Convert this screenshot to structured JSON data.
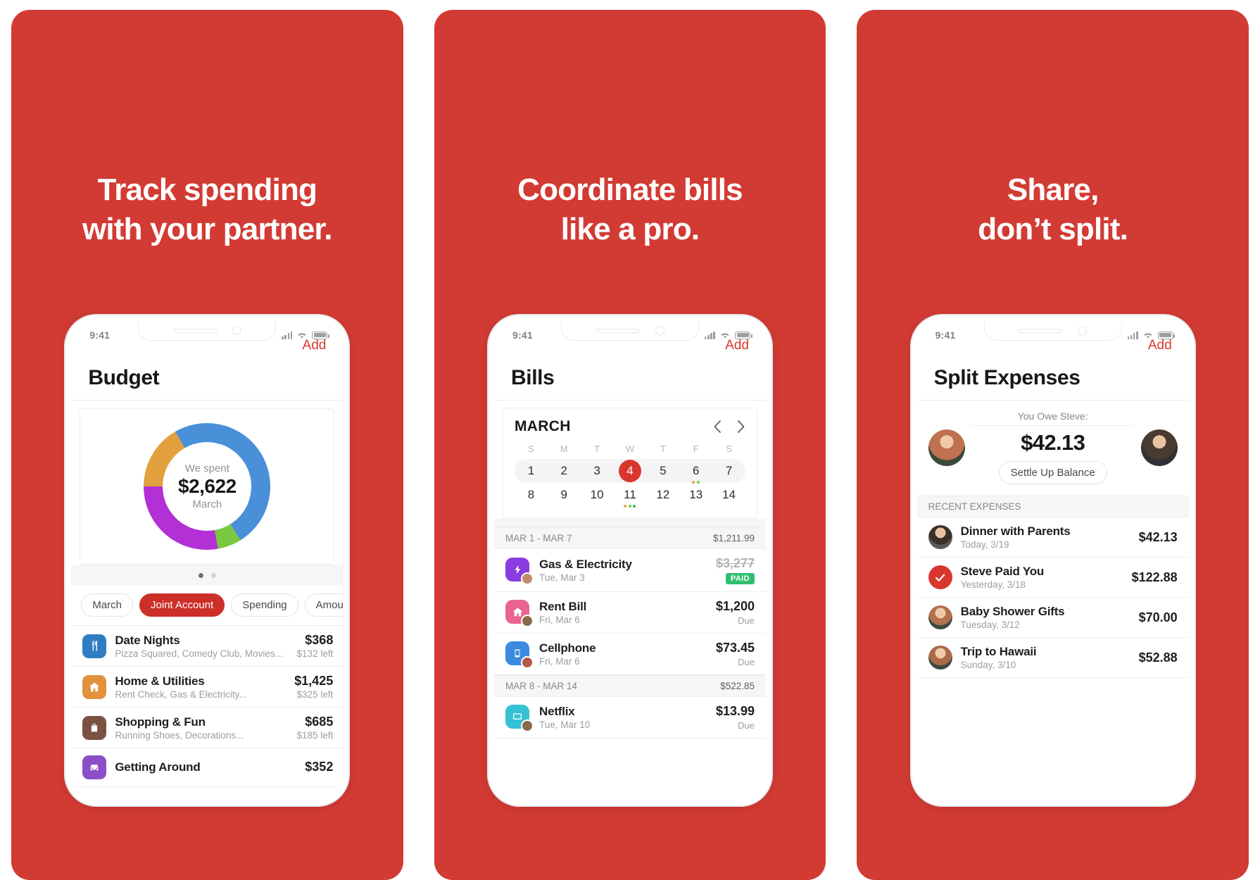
{
  "brand": {
    "red": "#d23b34",
    "accent": "#d9372e",
    "pill_red": "#cc2e28",
    "green": "#2fbf6f"
  },
  "panels": [
    {
      "headline_line1": "Track spending",
      "headline_line2": "with your partner.",
      "status": {
        "time": "9:41"
      },
      "nav": {
        "action": "Add",
        "title": "Budget"
      }
    },
    {
      "headline_line1": "Coordinate bills",
      "headline_line2": "like a pro.",
      "status": {
        "time": "9:41"
      },
      "nav": {
        "action": "Add",
        "title": "Bills"
      }
    },
    {
      "headline_line1": "Share,",
      "headline_line2": "don’t split.",
      "status": {
        "time": "9:41"
      },
      "nav": {
        "action": "Add",
        "title": "Split Expenses"
      }
    }
  ],
  "budget": {
    "donut": {
      "label_top": "We spent",
      "amount": "$2,622",
      "label_sub": "March"
    },
    "carousel": {
      "pages": 2,
      "active": 1
    },
    "pills": [
      {
        "label": "March",
        "active": false
      },
      {
        "label": "Joint Account",
        "active": true
      },
      {
        "label": "Spending",
        "active": false
      },
      {
        "label": "Amount: H",
        "active": false
      }
    ],
    "rows": [
      {
        "icon": "cutlery-icon",
        "color": "#2f7ec1",
        "title": "Date Nights",
        "sub": "Pizza Squared, Comedy Club, Movies...",
        "amount": "$368",
        "left": "$132 left"
      },
      {
        "icon": "home-icon",
        "color": "#e2913c",
        "title": "Home & Utilities",
        "sub": "Rent Check, Gas & Electricity...",
        "amount": "$1,425",
        "left": "$325 left"
      },
      {
        "icon": "bag-icon",
        "color": "#7a5242",
        "title": "Shopping & Fun",
        "sub": "Running Shoes, Decorations...",
        "amount": "$685",
        "left": "$185 left"
      },
      {
        "icon": "car-icon",
        "color": "#8a4fc7",
        "title": "Getting Around",
        "sub": "",
        "amount": "$352",
        "left": ""
      }
    ]
  },
  "chart_data": {
    "type": "pie",
    "title": "We spent $2,622 March",
    "labels": [
      "Home & Utilities",
      "Shopping & Fun",
      "Getting Around",
      "Date Nights"
    ],
    "values": [
      1425,
      685,
      352,
      368
    ],
    "colors": [
      "#4a90d9",
      "#b32fd6",
      "#e2a13c",
      "#7ac943"
    ],
    "segments": [
      {
        "name": "blue",
        "color": "#4a90d9",
        "start_deg": 0,
        "end_deg": 148
      },
      {
        "name": "green",
        "color": "#7ac943",
        "start_deg": 148,
        "end_deg": 170
      },
      {
        "name": "magenta",
        "color": "#b32fd6",
        "start_deg": 170,
        "end_deg": 270
      },
      {
        "name": "orange",
        "color": "#e2a13c",
        "start_deg": 270,
        "end_deg": 330
      },
      {
        "name": "blue2",
        "color": "#4a90d9",
        "start_deg": 330,
        "end_deg": 360
      }
    ],
    "center_text": [
      "We spent",
      "$2,622",
      "March"
    ],
    "legend": "none"
  },
  "bills": {
    "calendar": {
      "month": "MARCH",
      "prev_icon": "chevron-left-icon",
      "next_icon": "chevron-right-icon",
      "dow": [
        "S",
        "M",
        "T",
        "W",
        "T",
        "F",
        "S"
      ],
      "week1": [
        {
          "day": "1",
          "today": false,
          "dots": []
        },
        {
          "day": "2",
          "today": false,
          "dots": []
        },
        {
          "day": "3",
          "today": false,
          "dots": []
        },
        {
          "day": "4",
          "today": true,
          "dots": []
        },
        {
          "day": "5",
          "today": false,
          "dots": []
        },
        {
          "day": "6",
          "today": false,
          "dots": [
            "#e2a13c",
            "#7ac943"
          ]
        },
        {
          "day": "7",
          "today": false,
          "dots": []
        }
      ],
      "week2": [
        {
          "day": "8",
          "today": false,
          "dots": []
        },
        {
          "day": "9",
          "today": false,
          "dots": []
        },
        {
          "day": "10",
          "today": false,
          "dots": []
        },
        {
          "day": "11",
          "today": false,
          "dots": [
            "#e2a13c",
            "#7ac943",
            "#2fbf6f"
          ]
        },
        {
          "day": "12",
          "today": false,
          "dots": []
        },
        {
          "day": "13",
          "today": false,
          "dots": []
        },
        {
          "day": "14",
          "today": false,
          "dots": []
        }
      ]
    },
    "sections": [
      {
        "range": "MAR 1 - MAR 7",
        "total": "$1,211.99",
        "rows": [
          {
            "icon": "bolt-icon",
            "color": "#8a3ce0",
            "avatar": "#c38a6a",
            "title": "Gas & Electricity",
            "date": "Tue, Mar 3",
            "amount": "$3,277",
            "struck": true,
            "status": "",
            "badge": "PAID"
          },
          {
            "icon": "home-icon",
            "color": "#e8638f",
            "avatar": "#8a6a4a",
            "title": "Rent Bill",
            "date": "Fri, Mar 6",
            "amount": "$1,200",
            "struck": false,
            "status": "Due",
            "badge": ""
          },
          {
            "icon": "phone-icon",
            "color": "#3c8ae0",
            "avatar": "#b4564a",
            "title": "Cellphone",
            "date": "Fri, Mar 6",
            "amount": "$73.45",
            "struck": false,
            "status": "Due",
            "badge": ""
          }
        ]
      },
      {
        "range": "MAR 8 - MAR 14",
        "total": "$522.85",
        "rows": [
          {
            "icon": "tv-icon",
            "color": "#35c1d6",
            "avatar": "#8a6a4a",
            "title": "Netflix",
            "date": "Tue, Mar 10",
            "amount": "$13.99",
            "struck": false,
            "status": "Due",
            "badge": ""
          }
        ]
      }
    ]
  },
  "split": {
    "owe_label": "You Owe Steve:",
    "owe_amount": "$42.13",
    "settle_label": "Settle Up Balance",
    "left_avatar": "#c0714f",
    "right_avatar": "#6d6f74",
    "section_label": "RECENT EXPENSES",
    "expenses": [
      {
        "avatar": "#5b5e63",
        "type": "photo",
        "title": "Dinner with Parents",
        "date": "Today, 3/19",
        "amount": "$42.13"
      },
      {
        "avatar": "#d9372e",
        "type": "check",
        "title": "Steve Paid You",
        "date": "Yesterday, 3/18",
        "amount": "$122.88"
      },
      {
        "avatar": "#b1714c",
        "type": "photo",
        "title": "Baby Shower Gifts",
        "date": "Tuesday, 3/12",
        "amount": "$70.00"
      },
      {
        "avatar": "#ab6a48",
        "type": "photo",
        "title": "Trip to Hawaii",
        "date": "Sunday, 3/10",
        "amount": "$52.88"
      }
    ]
  }
}
